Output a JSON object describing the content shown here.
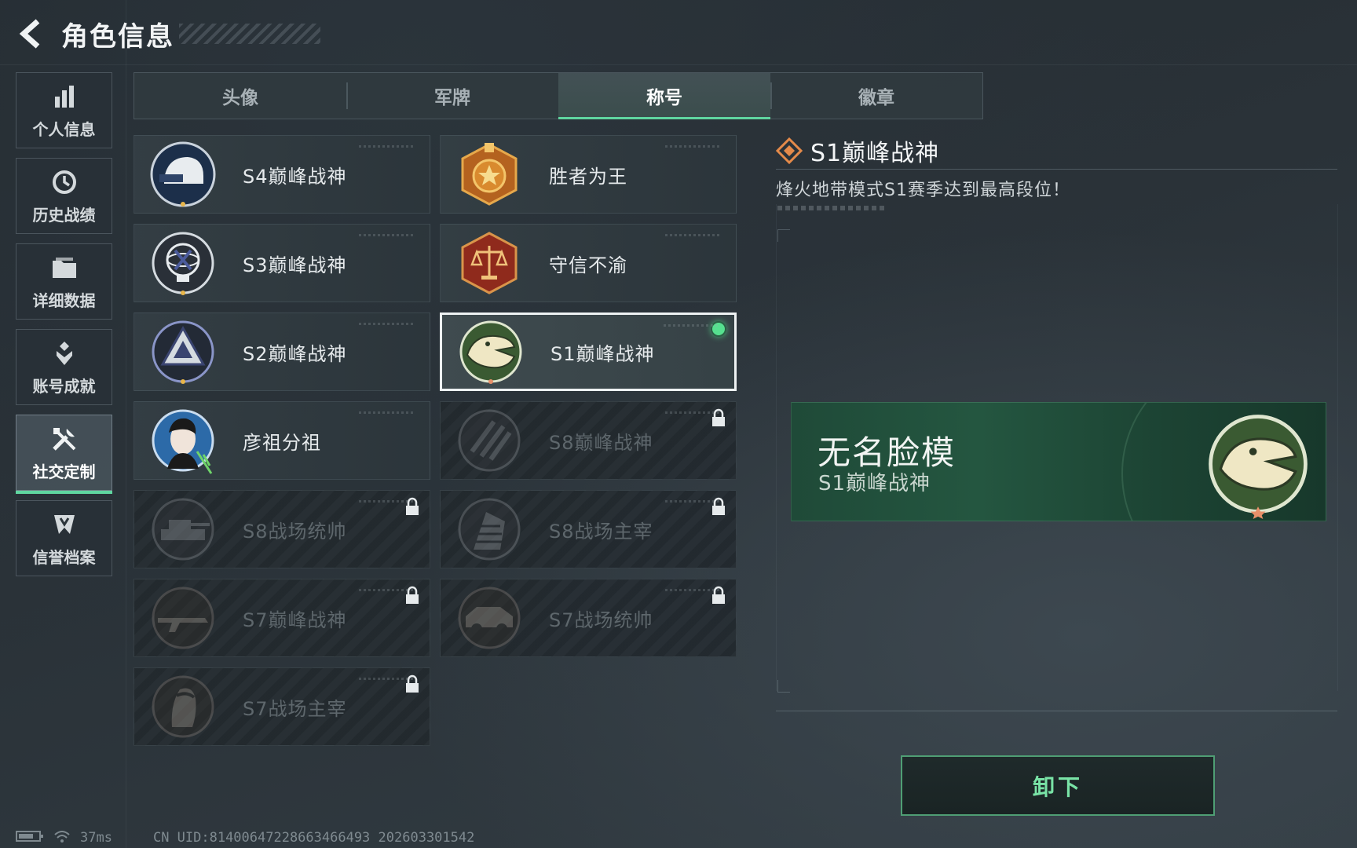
{
  "header": {
    "title": "角色信息"
  },
  "sidebar": {
    "items": [
      {
        "label": "个人信息",
        "icon": "bar-chart-icon",
        "active": false
      },
      {
        "label": "历史战绩",
        "icon": "history-clock-icon",
        "active": false
      },
      {
        "label": "详细数据",
        "icon": "folder-icon",
        "active": false
      },
      {
        "label": "账号成就",
        "icon": "achievement-icon",
        "active": false
      },
      {
        "label": "社交定制",
        "icon": "tools-icon",
        "active": true
      },
      {
        "label": "信誉档案",
        "icon": "credit-shield-icon",
        "active": false
      }
    ]
  },
  "tabs": [
    {
      "label": "头像",
      "active": false
    },
    {
      "label": "军牌",
      "active": false
    },
    {
      "label": "称号",
      "active": true
    },
    {
      "label": "徽章",
      "active": false
    }
  ],
  "titles": [
    {
      "name": "S4巅峰战神",
      "badge": "helmet-badge-icon",
      "locked": false,
      "selected": false
    },
    {
      "name": "胜者为王",
      "badge": "medal-badge-icon",
      "locked": false,
      "selected": false
    },
    {
      "name": "S3巅峰战神",
      "badge": "globe-badge-icon",
      "locked": false,
      "selected": false
    },
    {
      "name": "守信不渝",
      "badge": "scales-badge-icon",
      "locked": false,
      "selected": false
    },
    {
      "name": "S2巅峰战神",
      "badge": "triangle-badge-icon",
      "locked": false,
      "selected": false
    },
    {
      "name": "S1巅峰战神",
      "badge": "crocodile-badge-icon",
      "locked": false,
      "selected": true
    },
    {
      "name": "彦祖分祖",
      "badge": "portrait-badge-icon",
      "locked": false,
      "selected": false
    },
    {
      "name": "S8巅峰战神",
      "badge": "stripes-badge-icon",
      "locked": true,
      "selected": false
    },
    {
      "name": "S8战场统帅",
      "badge": "tank-badge-icon",
      "locked": true,
      "selected": false
    },
    {
      "name": "S8战场主宰",
      "badge": "building-badge-icon",
      "locked": true,
      "selected": false
    },
    {
      "name": "S7巅峰战神",
      "badge": "rifle-badge-icon",
      "locked": true,
      "selected": false
    },
    {
      "name": "S7战场统帅",
      "badge": "vehicle-badge-icon",
      "locked": true,
      "selected": false
    },
    {
      "name": "S7战场主宰",
      "badge": "soldier-badge-icon",
      "locked": true,
      "selected": false
    }
  ],
  "detail": {
    "title": "S1巅峰战神",
    "description": "烽火地带模式S1赛季达到最高段位！"
  },
  "preview": {
    "player_name": "无名脸模",
    "title": "S1巅峰战神"
  },
  "actions": {
    "unequip_label": "卸下"
  },
  "status": {
    "ping": "37ms",
    "uid": "CN UID:8140064722866346649З 202603301542"
  },
  "colors": {
    "accent": "#5fd6a0",
    "equipped": "#56e08f",
    "preview_bg": "#245640"
  }
}
